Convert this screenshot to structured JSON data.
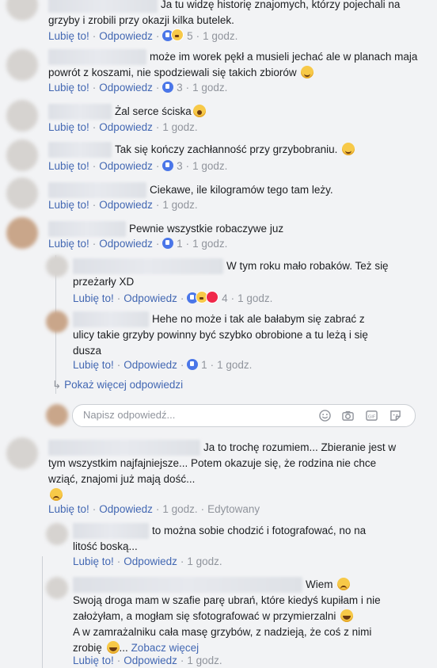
{
  "labels": {
    "like": "Lubię to!",
    "reply": "Odpowiedz",
    "edited": "Edytowany",
    "show_more_replies": "Pokaż więcej odpowiedzi",
    "see_more": "Zobacz więcej",
    "reply_placeholder": "Napisz odpowiedź..."
  },
  "comments": [
    {
      "text": "Ja tu widzę historię znajomych, którzy pojechali na grzyby i zrobili przy okazji kilka butelek.",
      "reactions": "5",
      "time": "1 godz."
    },
    {
      "text": "może im worek pękł a musieli jechać ale w planach maja powrót z koszami, nie spodziewali się takich zbiorów",
      "reactions": "3",
      "time": "1 godz."
    },
    {
      "text": "Żal serce ściska",
      "time": "1 godz."
    },
    {
      "text": "Tak się kończy zachłanność przy grzybobraniu.",
      "reactions": "3",
      "time": "1 godz."
    },
    {
      "text": "Ciekawe, ile kilogramów tego tam leży.",
      "time": "1 godz."
    },
    {
      "text": "Pewnie wszystkie robaczywe juz",
      "reactions": "1",
      "time": "1 godz."
    }
  ],
  "replies": [
    {
      "text_a": "W tym roku mało robaków. Też się",
      "text_b": "przeżarły XD",
      "reactions": "4",
      "time": "1 godz."
    },
    {
      "text_a": "Hehe no może i tak ale bałabym się zabrać z",
      "text_b": "ulicy takie grzyby powinny być szybko obrobione a tu leżą i się",
      "text_c": "dusza",
      "reactions": "1",
      "time": "1 godz."
    }
  ],
  "comment7": {
    "text_a": "Ja to trochę rozumiem... Zbieranie jest w",
    "text_b": "tym wszystkim najfajniejsze... Potem okazuje się, że rodzina nie chce",
    "text_c": "wziąć, znajomi już mają dość...",
    "time": "1 godz."
  },
  "replies2": [
    {
      "text_a": "to można sobie chodzić i fotografować, no na",
      "text_b": "litość boską...",
      "time": "1 godz."
    },
    {
      "text_a": "Wiem",
      "text_b": "Swoją droga mam w szafie parę ubrań, które kiedyś kupiłam i nie",
      "text_c": "założyłam, a mogłam się sfotografować w przymierzalni",
      "text_d": "A w zamrażalniku cała masę grzybów, z nadzieją, że coś z nimi",
      "text_e": "zrobię",
      "time": "1 godz."
    }
  ],
  "colors": {
    "link": "#4267b2",
    "muted": "#90949c",
    "bg": "#f2f3f5"
  }
}
